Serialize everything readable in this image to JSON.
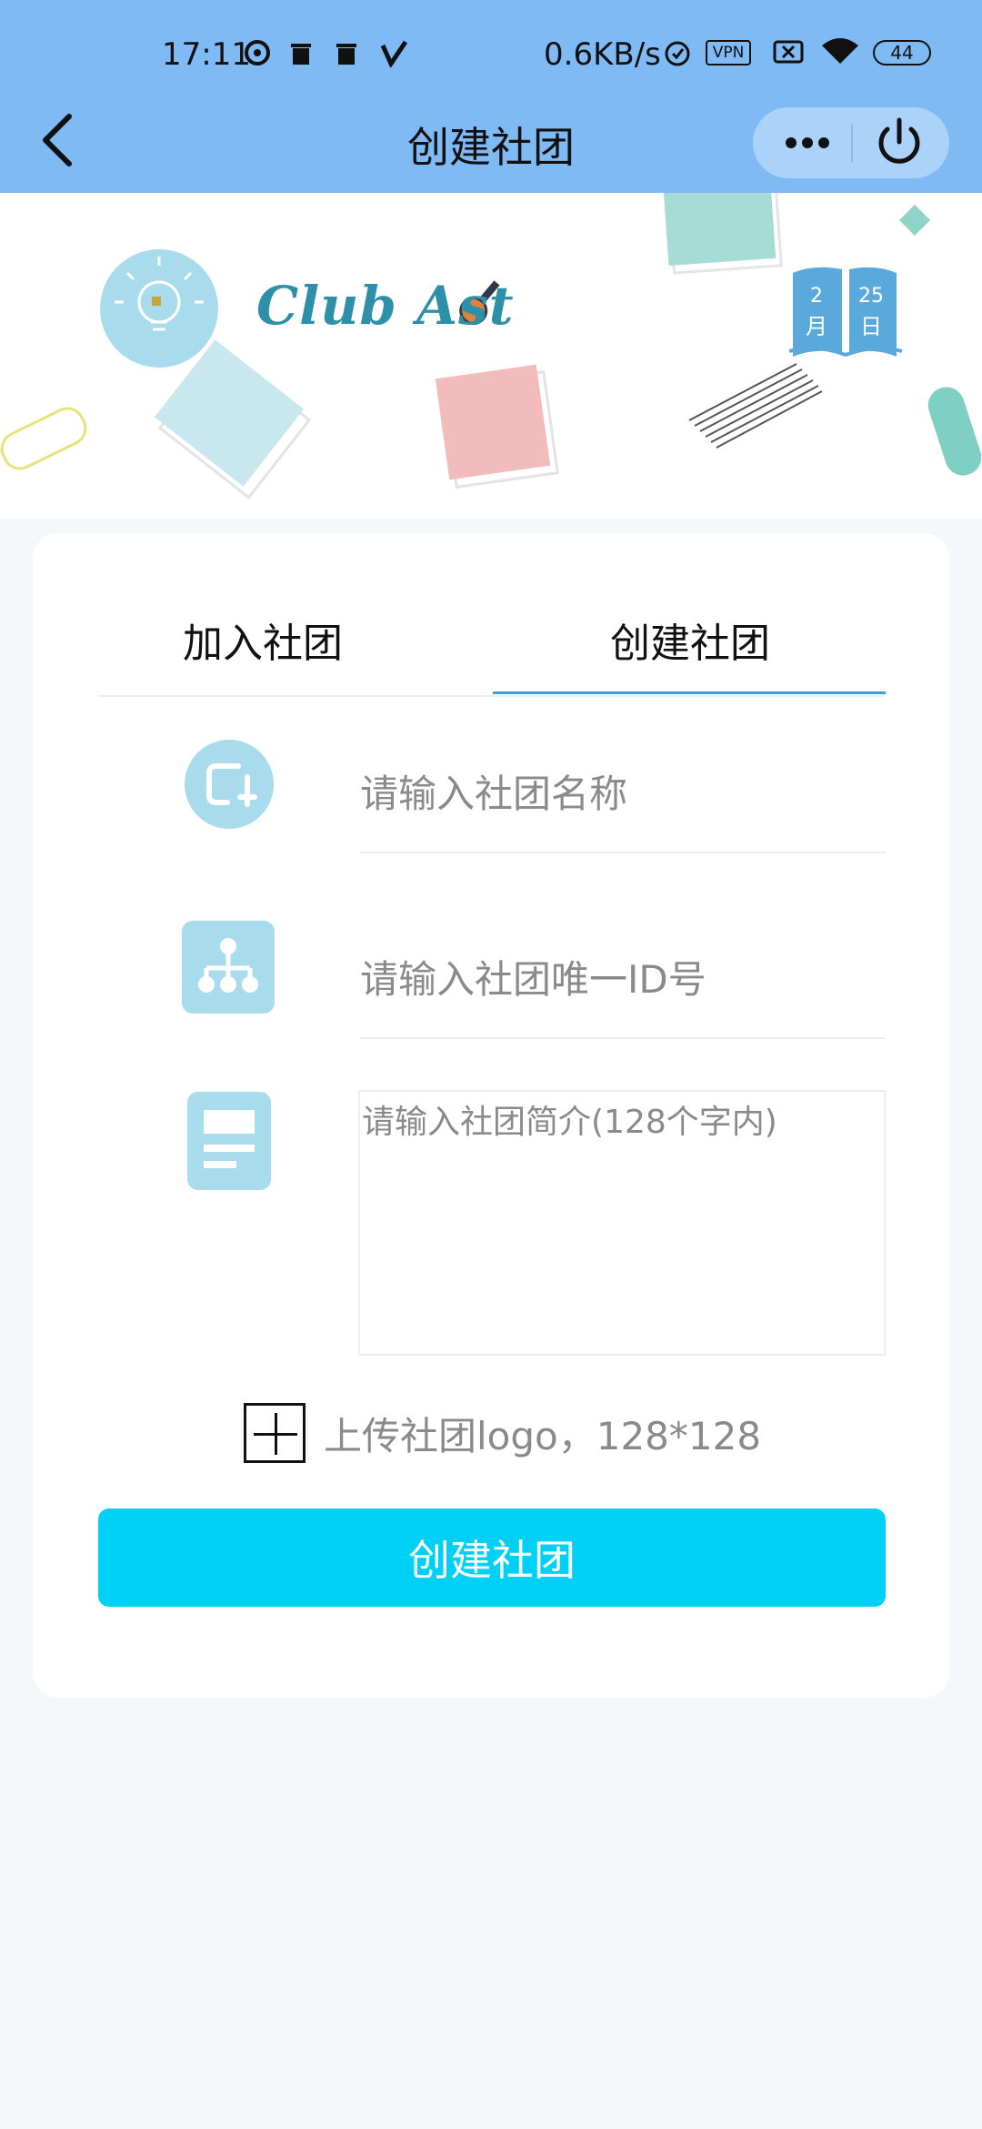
{
  "status_bar": {
    "time": "17:11",
    "net_speed": "0.6KB/s",
    "vpn": "VPN",
    "battery": "44"
  },
  "nav": {
    "title": "创建社团",
    "more_icon": "more-dots-icon",
    "close_icon": "power-icon"
  },
  "banner": {
    "brand": "Club Ast",
    "calendar_month_num": "2",
    "calendar_month_label": "月",
    "calendar_day_num": "25",
    "calendar_day_label": "日"
  },
  "tabs": [
    {
      "label": "加入社团",
      "active": false
    },
    {
      "label": "创建社团",
      "active": true
    }
  ],
  "form": {
    "name_placeholder": "请输入社团名称",
    "id_placeholder": "请输入社团唯一ID号",
    "intro_placeholder": "请输入社团简介(128个字内)",
    "upload_label": "上传社团logo，128*128",
    "submit_label": "创建社团"
  },
  "colors": {
    "header_bg": "#7fbaf5",
    "accent": "#00d0f5",
    "tab_underline": "#3fa0d8",
    "icon_bg": "#a8dcec"
  }
}
